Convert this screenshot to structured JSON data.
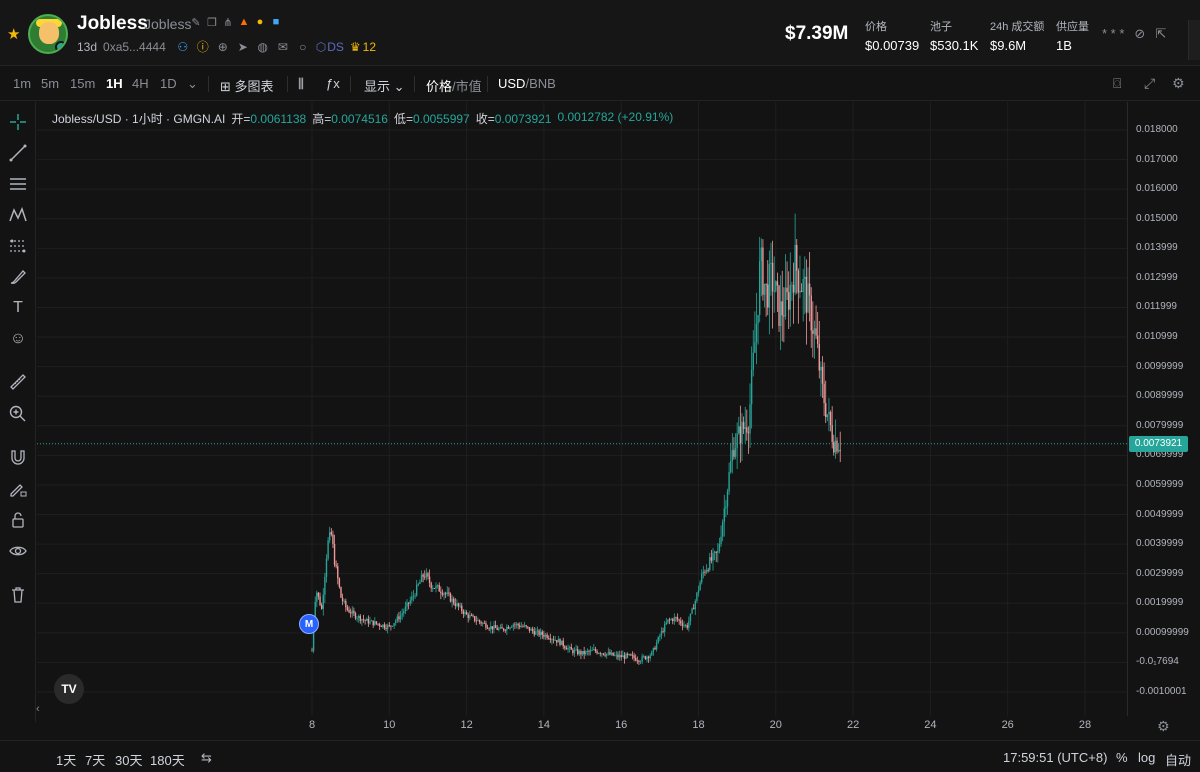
{
  "header": {
    "token_name": "Jobless",
    "token_sub": "Jobless",
    "age": "13d",
    "address": "0xa5...4444",
    "ds_label": "DS",
    "crown_count": "12",
    "market_cap": "$7.39M",
    "stats": [
      {
        "label": "价格",
        "value": "$0.00739"
      },
      {
        "label": "池子",
        "value": "$530.1K"
      },
      {
        "label": "24h 成交额",
        "value": "$9.6M"
      },
      {
        "label": "供应量",
        "value": "1B"
      }
    ],
    "more_dots": "* * *"
  },
  "toolbar": {
    "intervals": [
      {
        "label": "1m",
        "active": false
      },
      {
        "label": "5m",
        "active": false
      },
      {
        "label": "15m",
        "active": false
      },
      {
        "label": "1H",
        "active": true
      },
      {
        "label": "4H",
        "active": false
      },
      {
        "label": "1D",
        "active": false
      }
    ],
    "multi_chart": "多图表",
    "display": "显示",
    "price_label": "价格",
    "mcap_label": "市值",
    "usd_label": "USD",
    "bnb_label": "BNB"
  },
  "legend": {
    "symbol": "Jobless/USD · 1小时 · GMGN.AI",
    "open_label": "开=",
    "open": "0.0061138",
    "high_label": "高=",
    "high": "0.0074516",
    "low_label": "低=",
    "low": "0.0055997",
    "close_label": "收=",
    "close": "0.0073921",
    "change": "0.0012782 (+20.91%)"
  },
  "chart_data": {
    "type": "candlestick",
    "x_ticks": [
      "8",
      "10",
      "12",
      "14",
      "16",
      "18",
      "20",
      "22",
      "24",
      "26",
      "28"
    ],
    "y_ticks": [
      "0.018000",
      "0.017000",
      "0.016000",
      "0.015000",
      "0.013999",
      "0.012999",
      "0.011999",
      "0.010999",
      "0.0099999",
      "0.0089999",
      "0.0079999",
      "0.0069999",
      "0.0059999",
      "0.0049999",
      "0.0039999",
      "0.0029999",
      "0.0019999",
      "0.00099999",
      "-0.0₁7694",
      "-0.0010001"
    ],
    "ylim": [
      -0.0010001,
      0.018
    ],
    "current_price": "0.0073921",
    "up_color": "#26a69a",
    "down_color": "#ef9a9a",
    "close_path": [
      [
        8.0,
        0.0004
      ],
      [
        8.1,
        0.0025
      ],
      [
        8.25,
        0.0018
      ],
      [
        8.4,
        0.004
      ],
      [
        8.5,
        0.0043
      ],
      [
        8.6,
        0.0033
      ],
      [
        8.75,
        0.0022
      ],
      [
        8.9,
        0.0018
      ],
      [
        9.1,
        0.0016
      ],
      [
        9.4,
        0.0014
      ],
      [
        9.7,
        0.0013
      ],
      [
        10.0,
        0.0012
      ],
      [
        10.3,
        0.0016
      ],
      [
        10.6,
        0.0022
      ],
      [
        10.9,
        0.003
      ],
      [
        11.1,
        0.0026
      ],
      [
        11.4,
        0.0024
      ],
      [
        11.7,
        0.002
      ],
      [
        12.0,
        0.0016
      ],
      [
        12.3,
        0.0014
      ],
      [
        12.6,
        0.0012
      ],
      [
        12.9,
        0.0011
      ],
      [
        13.2,
        0.0013
      ],
      [
        13.5,
        0.0012
      ],
      [
        13.8,
        0.001
      ],
      [
        14.1,
        0.0009
      ],
      [
        14.4,
        0.0007
      ],
      [
        14.7,
        0.0004
      ],
      [
        15.0,
        0.0003
      ],
      [
        15.3,
        0.0004
      ],
      [
        15.6,
        0.0003
      ],
      [
        15.9,
        0.0002
      ],
      [
        16.2,
        0.0002
      ],
      [
        16.5,
        0.0001
      ],
      [
        16.8,
        0.0003
      ],
      [
        17.0,
        0.0009
      ],
      [
        17.2,
        0.0014
      ],
      [
        17.4,
        0.0015
      ],
      [
        17.7,
        0.0012
      ],
      [
        17.9,
        0.002
      ],
      [
        18.1,
        0.003
      ],
      [
        18.3,
        0.0034
      ],
      [
        18.5,
        0.0037
      ],
      [
        18.7,
        0.0055
      ],
      [
        18.9,
        0.0073
      ],
      [
        19.1,
        0.0078
      ],
      [
        19.3,
        0.0082
      ],
      [
        19.5,
        0.0115
      ],
      [
        19.6,
        0.0135
      ],
      [
        19.75,
        0.0125
      ],
      [
        19.9,
        0.013
      ],
      [
        20.1,
        0.0118
      ],
      [
        20.3,
        0.0122
      ],
      [
        20.5,
        0.0135
      ],
      [
        20.6,
        0.013
      ],
      [
        20.75,
        0.0126
      ],
      [
        20.9,
        0.0118
      ],
      [
        21.05,
        0.0108
      ],
      [
        21.2,
        0.0092
      ],
      [
        21.35,
        0.0083
      ],
      [
        21.5,
        0.0075
      ],
      [
        21.7,
        0.0074
      ]
    ]
  },
  "bottom": {
    "ranges": [
      "1天",
      "7天",
      "30天",
      "180天"
    ],
    "clock": "17:59:51 (UTC+8)",
    "percent": "%",
    "log": "log",
    "auto": "自动"
  },
  "markers": {
    "m_label": "M",
    "tv_logo": "TV"
  }
}
